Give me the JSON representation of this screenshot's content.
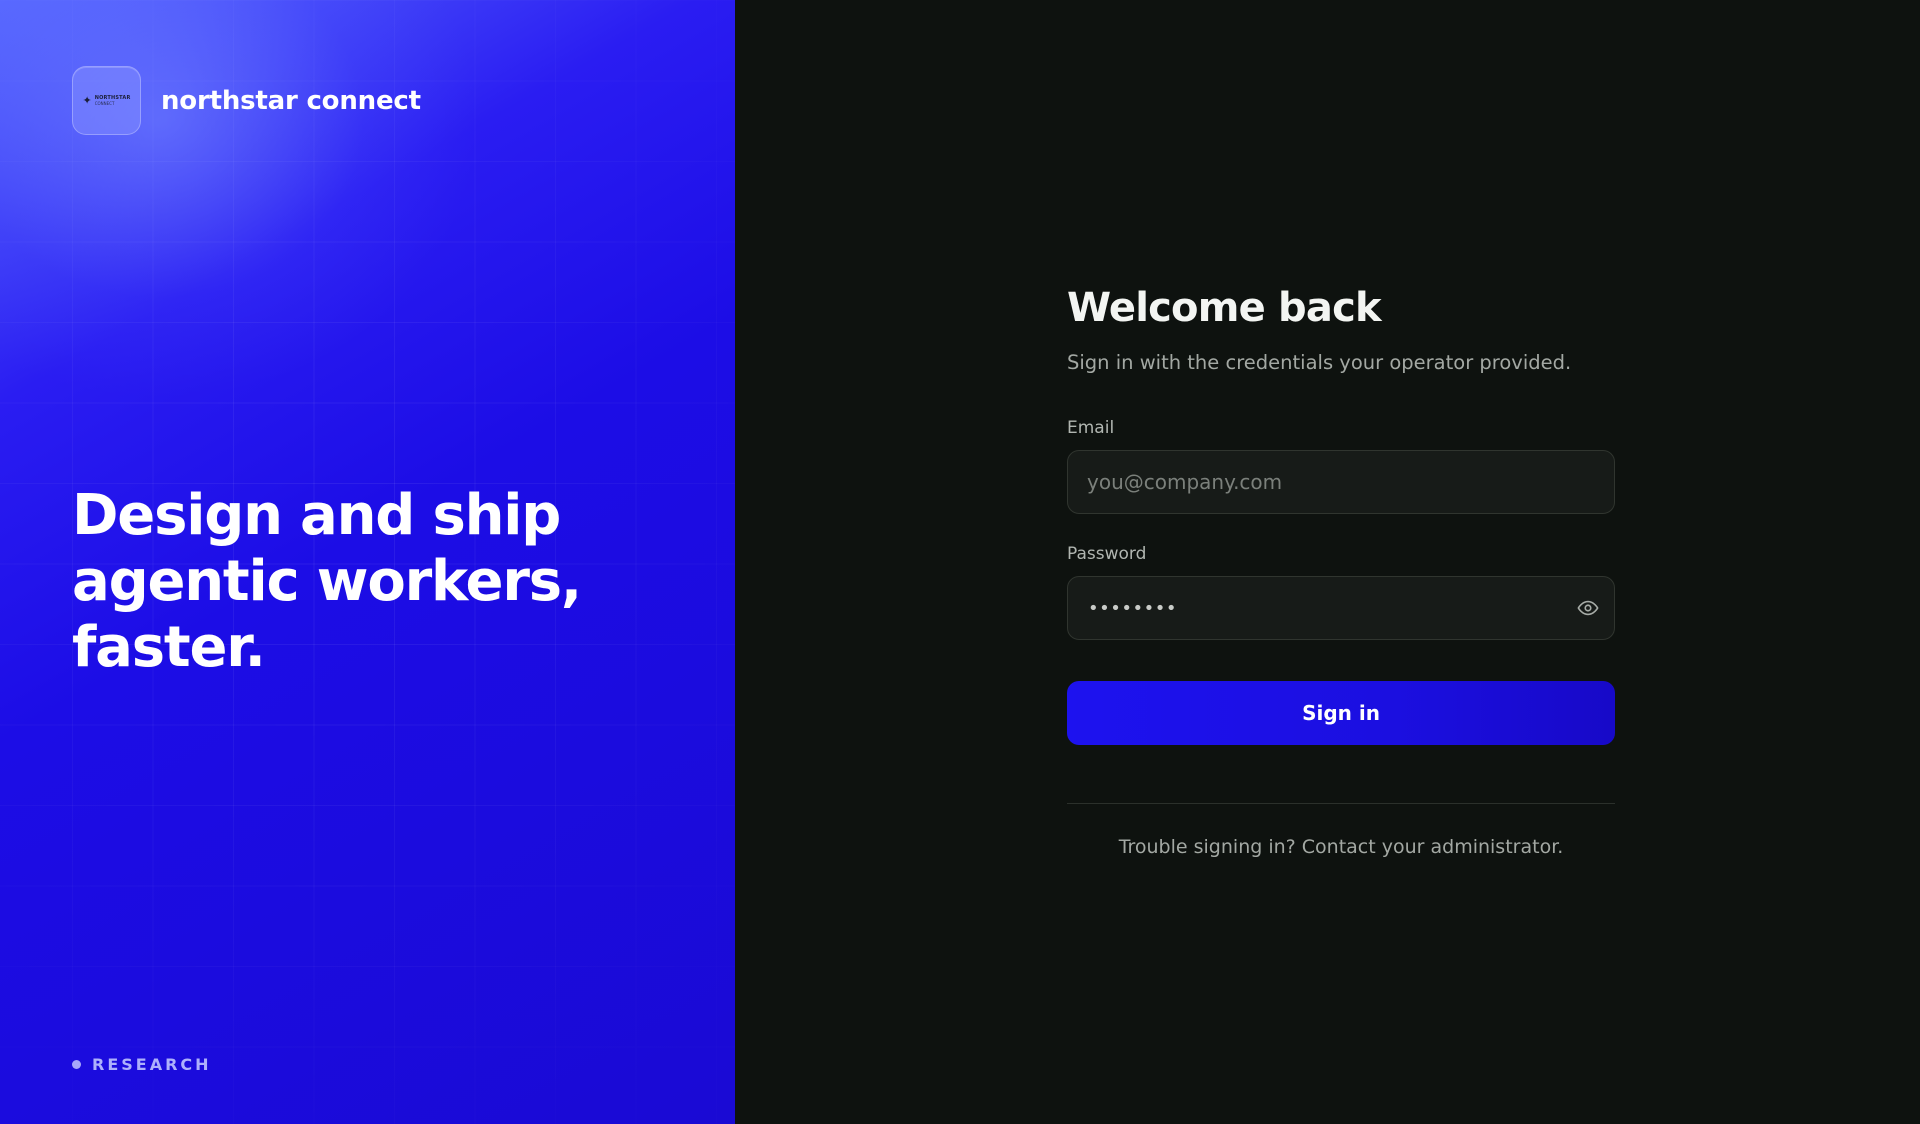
{
  "brand": {
    "name": "northstar connect",
    "logo_text_line1": "NORTHSTAR",
    "logo_text_line2": "CONNECT",
    "logo_icon": "star-icon"
  },
  "hero": {
    "headline_lines": [
      "Design and ship",
      "agentic workers,",
      "faster."
    ],
    "tag": "RESEARCH"
  },
  "form": {
    "title": "Welcome back",
    "subtitle": "Sign in with the credentials your operator provided.",
    "email": {
      "label": "Email",
      "placeholder": "you@company.com",
      "value": ""
    },
    "password": {
      "label": "Password",
      "masked_value": "••••••••",
      "toggle_icon": "eye-icon"
    },
    "submit_label": "Sign in",
    "help_text": "Trouble signing in? Contact your administrator."
  },
  "colors": {
    "accent": "#1d12ef",
    "panel_bg": "#0e120f",
    "input_bg": "#171b18",
    "hero_start": "#5a6cff",
    "hero_end": "#1a0ad4"
  }
}
